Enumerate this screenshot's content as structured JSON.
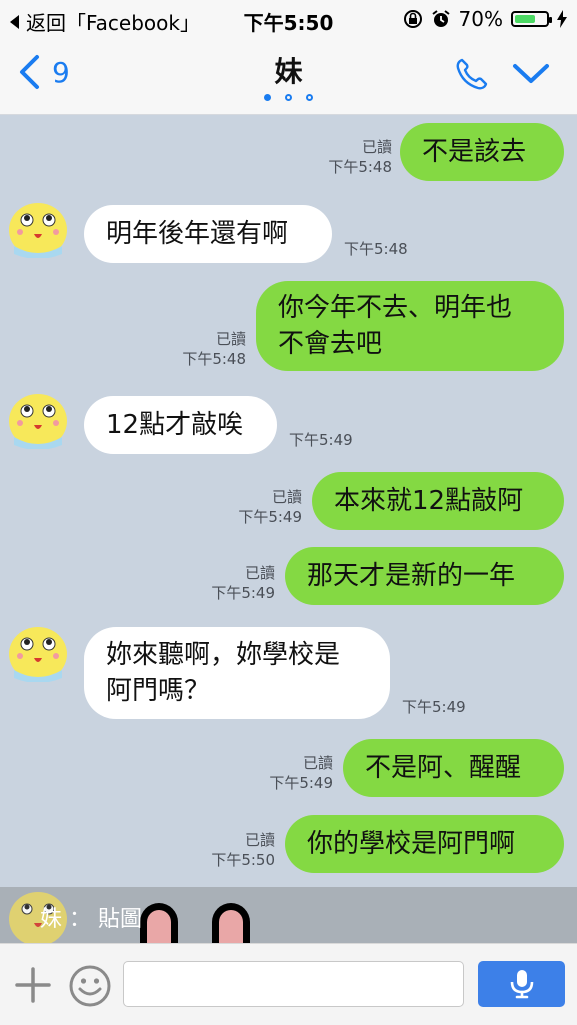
{
  "status_bar": {
    "back_app": "返回「Facebook」",
    "time": "下午5:50",
    "battery_percent": "70%",
    "battery_level": 0.7
  },
  "nav": {
    "back_count": "9",
    "title": "妹",
    "page_dots": 3,
    "active_dot": 0,
    "accent_color": "#1a7cf0"
  },
  "messages": [
    {
      "side": "out",
      "text": "不是該去",
      "read": "已讀",
      "time": "下午5:48"
    },
    {
      "side": "in",
      "text": "明年後年還有啊",
      "time": "下午5:48"
    },
    {
      "side": "out",
      "lines": [
        "你今年不去、明年也",
        "不會去吧"
      ],
      "read": "已讀",
      "time": "下午5:48"
    },
    {
      "side": "in",
      "text": "12點才敲唉",
      "time": "下午5:49"
    },
    {
      "side": "out",
      "text": "本來就12點敲阿",
      "read": "已讀",
      "time": "下午5:49"
    },
    {
      "side": "out",
      "text": "那天才是新的一年",
      "read": "已讀",
      "time": "下午5:49"
    },
    {
      "side": "in",
      "lines": [
        "妳來聽啊，妳學校是",
        "阿門嗎？"
      ],
      "time": "下午5:49"
    },
    {
      "side": "out",
      "text": "不是阿、醒醒",
      "read": "已讀",
      "time": "下午5:49"
    },
    {
      "side": "out",
      "text": "你的學校是阿門啊",
      "read": "已讀",
      "time": "下午5:50"
    }
  ],
  "preview": {
    "text": "妹 ： 貼圖"
  },
  "input": {
    "placeholder": "",
    "value": ""
  },
  "colors": {
    "chat_bg": "#c9d3df",
    "out_bubble": "#84d943",
    "in_bubble": "#ffffff",
    "mic_button": "#3d80e8"
  }
}
